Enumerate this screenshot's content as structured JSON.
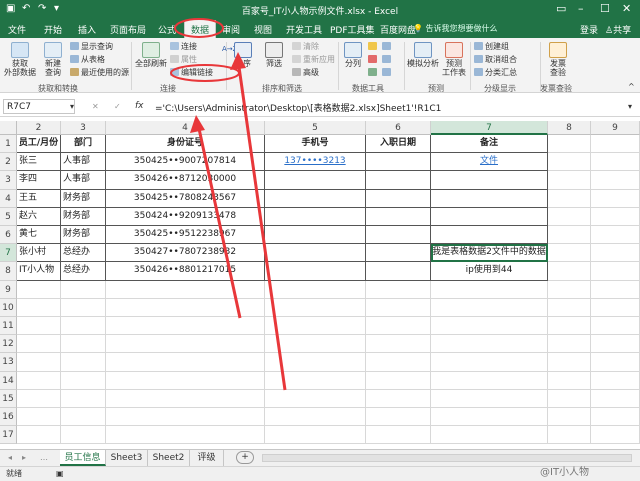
{
  "app": {
    "title": "百家号_IT小人物示例文件.xlsx - Excel",
    "login": "登录",
    "share": "共享",
    "tellme": "告诉我您想要做什么"
  },
  "ribbon_tabs": [
    "文件",
    "开始",
    "插入",
    "页面布局",
    "公式",
    "数据",
    "审阅",
    "视图",
    "开发工具",
    "PDF工具集",
    "百度网盘"
  ],
  "active_tab": "数据",
  "ribbon": {
    "get_external": "获取\n外部数据",
    "new_query": "新建\n查询",
    "show_queries": "显示查询",
    "from_table": "从表格",
    "recent_sources": "最近使用的源",
    "group_get": "获取和转换",
    "refresh_all": "全部刷新",
    "connections": "连接",
    "properties": "属性",
    "edit_links": "编辑链接",
    "group_conn": "连接",
    "sort_az": "A→Z",
    "sort": "排序",
    "filter": "筛选",
    "clear": "清除",
    "reapply": "重新应用",
    "advanced": "高级",
    "group_sort": "排序和筛选",
    "text_to_cols": "分列",
    "group_tools": "数据工具",
    "what_if": "模拟分析",
    "forecast_sheet": "预测\n工作表",
    "group_forecast": "预测",
    "group": "创建组",
    "ungroup": "取消组合",
    "subtotal": "分类汇总",
    "group_outline": "分级显示",
    "invoice": "发票\n查验",
    "group_invoice": "发票查验"
  },
  "formula_bar": {
    "name_box": "R7C7",
    "fx": "fx",
    "formula": "='C:\\Users\\Administrator\\Desktop\\[表格数据2.xlsx]Sheet1'!R1C1"
  },
  "columns": [
    "2",
    "3",
    "4",
    "5",
    "6",
    "7",
    "8",
    "9"
  ],
  "selected_column": "7",
  "rows": [
    "1",
    "2",
    "3",
    "4",
    "5",
    "6",
    "7",
    "8",
    "9",
    "10",
    "11",
    "12",
    "13",
    "14",
    "15",
    "16",
    "17"
  ],
  "selected_row": "7",
  "table": {
    "headers": [
      "员工/月份",
      "部门",
      "身份证号",
      "手机号",
      "入职日期",
      "备注"
    ],
    "rows": [
      [
        "张三",
        "人事部",
        "350425••9007207814",
        "137••••3213",
        "",
        "文件"
      ],
      [
        "李四",
        "人事部",
        "350426••8712030000",
        "",
        "",
        ""
      ],
      [
        "王五",
        "财务部",
        "350425••7808243567",
        "",
        "",
        ""
      ],
      [
        "赵六",
        "财务部",
        "350424••9209133478",
        "",
        "",
        ""
      ],
      [
        "黄七",
        "财务部",
        "350425••9512238967",
        "",
        "",
        ""
      ],
      [
        "张小村",
        "总经办",
        "350427••7807238932",
        "",
        "",
        "我是表格数据2文件中的数据"
      ],
      [
        "IT小人物",
        "总经办",
        "350426••8801217015",
        "",
        "",
        "ip使用到44"
      ]
    ]
  },
  "sheet_tabs": [
    "员工信息",
    "Sheet3",
    "Sheet2",
    "评级"
  ],
  "active_sheet": "员工信息",
  "add_sheet": "+",
  "status": {
    "ready": "就绪",
    "watermark": "@IT小人物"
  },
  "colors": {
    "excel_green": "#217346",
    "annotation_red": "#e8373a",
    "link_blue": "#2a6fc9"
  }
}
